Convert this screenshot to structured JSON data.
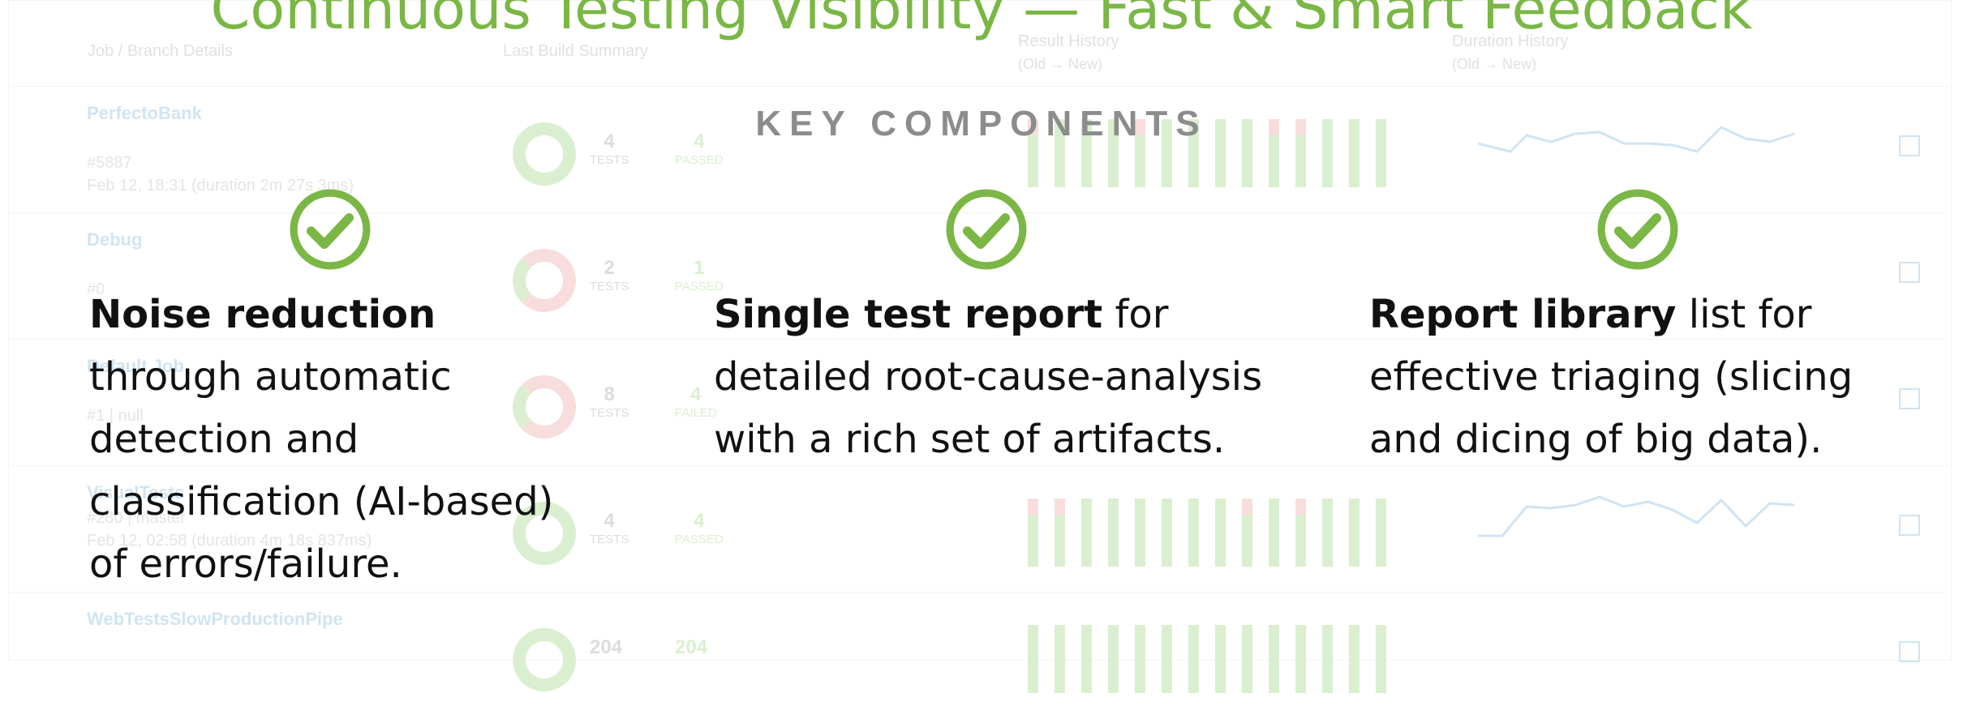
{
  "slide": {
    "title": "Continuous Testing Visibility — Fast & Smart Feedback",
    "subtitle": "KEY COMPONENTS",
    "accent_color": "#7ab745",
    "components": [
      {
        "icon": "check-circle-icon",
        "bold": "Noise reduction",
        "text": " through automatic detection and classification (AI-based) of errors/failure."
      },
      {
        "icon": "check-circle-icon",
        "bold": "Single test report",
        "text": " for detailed root-cause-analysis with a rich set of artifacts."
      },
      {
        "icon": "check-circle-icon",
        "bold": "Report library",
        "text": " list for effective triaging (slicing and dicing of big data)."
      }
    ]
  },
  "background_dashboard": {
    "headers": {
      "job": "Job / Branch Details",
      "summary": "Last Build Summary",
      "result_history": "Result History",
      "result_history_sub": "(Old → New)",
      "duration_history": "Duration History",
      "duration_history_sub": "(Old → New)"
    },
    "rows": [
      {
        "job": "PerfectoBank",
        "build": "#5887",
        "time": "Feb 12, 18:31 (duration 2m 27s 3ms)",
        "tests": "4",
        "tests_label": "TESTS",
        "passed": "4",
        "passed_label": "PASSED"
      },
      {
        "job": "Debug",
        "build": "#0",
        "time": "",
        "tests": "2",
        "tests_label": "TESTS",
        "passed": "1",
        "passed_label": "PASSED"
      },
      {
        "job": "Default Job",
        "build": "#1 | null",
        "time": "",
        "tests": "8",
        "tests_label": "TESTS",
        "passed": "4",
        "passed_label": "FAILED"
      },
      {
        "job": "VisualTests",
        "build": "#280 | master",
        "time": "Feb 12, 02:58 (duration 4m 18s 837ms)",
        "tests": "4",
        "tests_label": "TESTS",
        "passed": "4",
        "passed_label": "PASSED"
      },
      {
        "job": "WebTestsSlowProductionPipe",
        "build": "",
        "time": "",
        "tests": "204",
        "tests_label": "",
        "passed": "204",
        "passed_label": ""
      }
    ]
  }
}
